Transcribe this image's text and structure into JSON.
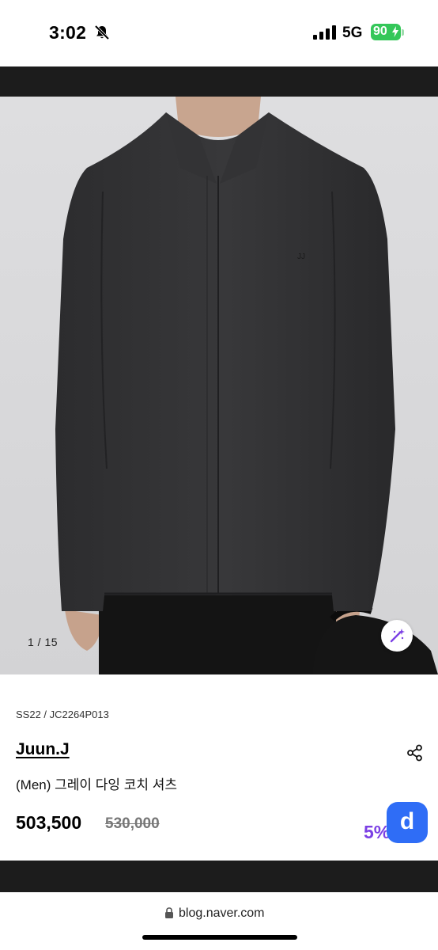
{
  "status_bar": {
    "time": "3:02",
    "network": "5G",
    "battery": "90"
  },
  "icons": {
    "bell": "bell-slash-icon",
    "signal": "cellular-signal-icon",
    "magic": "magic-wand-icon",
    "share": "share-icon",
    "lock": "lock-icon"
  },
  "gallery": {
    "counter": "1 / 15"
  },
  "product": {
    "season_code": "SS22 / JC2264P013",
    "brand": "Juun.J",
    "title": "(Men) 그레이 다잉 코치 셔츠",
    "price": "503,500",
    "original_price": "530,000",
    "discount": "5%"
  },
  "app_badge": {
    "letter": "d",
    "color": "#2f6df6"
  },
  "browser": {
    "url": "blog.naver.com"
  },
  "colors": {
    "discount": "#7b3fe4",
    "battery": "#34c759",
    "band": "#1c1c1c"
  }
}
